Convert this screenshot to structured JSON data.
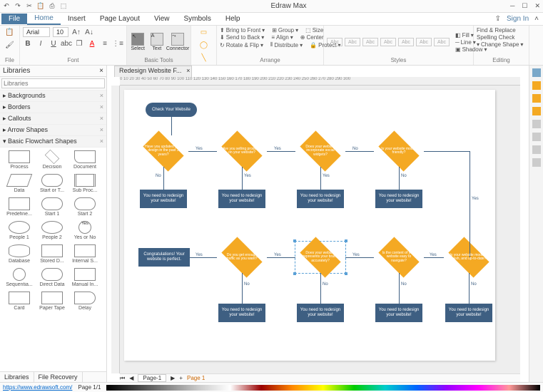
{
  "app": {
    "title": "Edraw Max",
    "signin": "Sign In"
  },
  "qat": [
    "↶",
    "↷",
    "✂",
    "📋",
    "⎙",
    "⬚"
  ],
  "menu": {
    "file": "File",
    "tabs": [
      "Home",
      "Insert",
      "Page Layout",
      "View",
      "Symbols",
      "Help"
    ],
    "active": "Home"
  },
  "ribbon": {
    "file_group": "File",
    "font": {
      "name": "Arial",
      "size": "10",
      "label": "Font"
    },
    "basic": {
      "select": "Select",
      "text": "Text",
      "connector": "Connector",
      "label": "Basic Tools"
    },
    "arrange": {
      "items": [
        "Bring to Front",
        "Send to Back",
        "Rotate & Flip",
        "Group",
        "Align",
        "Distribute",
        "Size",
        "Center",
        "Protect"
      ],
      "label": "Arrange"
    },
    "styles": {
      "buttons": [
        "Abc",
        "Abc",
        "Abc",
        "Abc",
        "Abc",
        "Abc",
        "Abc"
      ],
      "fill": "Fill",
      "line": "Line",
      "shadow": "Shadow",
      "label": "Styles"
    },
    "editing": {
      "items": [
        "Find & Replace",
        "Spelling Check",
        "Change Shape"
      ],
      "label": "Editing"
    }
  },
  "libraries": {
    "title": "Libraries",
    "cats": [
      "Backgrounds",
      "Borders",
      "Callouts",
      "Arrow Shapes",
      "Basic Flowchart Shapes"
    ],
    "shapes": [
      [
        "Process",
        "Decision",
        "Document"
      ],
      [
        "Data",
        "Start or T...",
        "Sub Proc..."
      ],
      [
        "Predefine...",
        "Start 1",
        "Start 2"
      ],
      [
        "People 1",
        "People 2",
        "Yes or No"
      ],
      [
        "Database",
        "Stored D...",
        "Internal S..."
      ],
      [
        "Sequentia...",
        "Direct Data",
        "Manual In..."
      ],
      [
        "Card",
        "Paper Tape",
        "Delay"
      ]
    ],
    "tabs": [
      "Libraries",
      "File Recovery"
    ]
  },
  "doc": {
    "tab": "Redesign Website F...",
    "page_tab": "Page-1",
    "page_alt": "Page 1"
  },
  "flowchart": {
    "start": "Check Your Website",
    "d1": "Have you updated your design in the past 3 years?",
    "d2": "Are you selling products on your website?",
    "d3": "Does your website incorporate social widgets?",
    "d4": "Is your website mobile friendly?",
    "d5": "Do you get enough traffic as you want?",
    "d6": "Does your website represents your brand accurately?",
    "d7": "Is the content of your website easy to navigate?",
    "d8": "Is your website modern, fresh, and up-to-date?",
    "redesign": "You need to redesign your website!",
    "perfect": "Congratulations! Your website is perfect.",
    "yes": "Yes",
    "no": "No"
  },
  "ruler": "0    10    20    30    40    50    60    70    80    90    100    110    120    130    140    150    160    170    180    190    200    210    220    230    240    250    260    270    280    290    300",
  "status": {
    "url": "https://www.edrawsoft.com/",
    "page": "Page 1/1"
  }
}
